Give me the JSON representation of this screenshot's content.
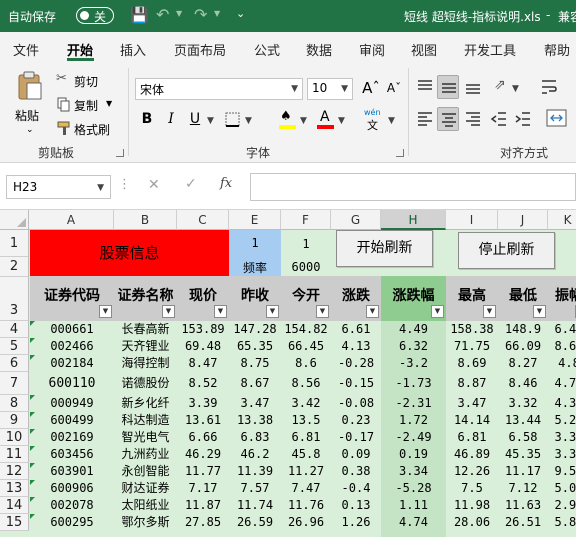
{
  "titlebar": {
    "autosave_label": "自动保存",
    "autosave_state": "关",
    "filename": "短线 超短线-指标说明.xls",
    "separator": "-",
    "user": "兼容"
  },
  "tabs": [
    "文件",
    "开始",
    "插入",
    "页面布局",
    "公式",
    "数据",
    "审阅",
    "视图",
    "开发工具",
    "帮助"
  ],
  "active_tab": "开始",
  "clipboard": {
    "paste": "粘贴",
    "cut": "剪切",
    "copy": "复制",
    "format_painter": "格式刷",
    "group": "剪贴板"
  },
  "font": {
    "name": "宋体",
    "size": "10",
    "bold": "B",
    "italic": "I",
    "underline": "U",
    "phonetic": "wén",
    "group": "字体"
  },
  "alignment": {
    "group": "对齐方式"
  },
  "formula_bar": {
    "name_box": "H23",
    "fx": "fx",
    "formula": ""
  },
  "columns": [
    "A",
    "B",
    "C",
    "E",
    "F",
    "G",
    "H",
    "I",
    "J",
    "K"
  ],
  "rows": [
    "1",
    "2",
    "3",
    "4",
    "5",
    "6",
    "7",
    "8",
    "9",
    "10",
    "11",
    "12",
    "13",
    "14",
    "15"
  ],
  "sheet": {
    "stock_info": "股票信息",
    "e1": "1",
    "e2": "频率",
    "f1": "1",
    "f2": "6000",
    "start_button": "开始刷新",
    "stop_button": "停止刷新",
    "headers": [
      "证券代码",
      "证券名称",
      "现价",
      "昨收",
      "今开",
      "涨跌",
      "涨跌幅",
      "最高",
      "最低",
      "振幅"
    ],
    "data": [
      [
        "000661",
        "长春高新",
        "153.89",
        "147.28",
        "154.82",
        "6.61",
        "4.49",
        "158.38",
        "148.9",
        "6.44"
      ],
      [
        "002466",
        "天齐锂业",
        "69.48",
        "65.35",
        "66.45",
        "4.13",
        "6.32",
        "71.75",
        "66.09",
        "8.66"
      ],
      [
        "002184",
        "海得控制",
        "8.47",
        "8.75",
        "8.6",
        "-0.28",
        "-3.2",
        "8.69",
        "8.27",
        "4.8"
      ],
      [
        "600110",
        "诺德股份",
        "8.52",
        "8.67",
        "8.56",
        "-0.15",
        "-1.73",
        "8.87",
        "8.46",
        "4.73"
      ],
      [
        "000949",
        "新乡化纤",
        "3.39",
        "3.47",
        "3.42",
        "-0.08",
        "-2.31",
        "3.47",
        "3.32",
        "4.32"
      ],
      [
        "600499",
        "科达制造",
        "13.61",
        "13.38",
        "13.5",
        "0.23",
        "1.72",
        "14.14",
        "13.44",
        "5.23"
      ],
      [
        "002169",
        "智光电气",
        "6.66",
        "6.83",
        "6.81",
        "-0.17",
        "-2.49",
        "6.81",
        "6.58",
        "3.37"
      ],
      [
        "603456",
        "九洲药业",
        "46.29",
        "46.2",
        "45.8",
        "0.09",
        "0.19",
        "46.89",
        "45.35",
        "3.33"
      ],
      [
        "603901",
        "永创智能",
        "11.77",
        "11.39",
        "11.27",
        "0.38",
        "3.34",
        "12.26",
        "11.17",
        "9.57"
      ],
      [
        "600906",
        "财达证券",
        "7.17",
        "7.57",
        "7.47",
        "-0.4",
        "-5.28",
        "7.5",
        "7.12",
        "5.02"
      ],
      [
        "002078",
        "太阳纸业",
        "11.87",
        "11.74",
        "11.76",
        "0.13",
        "1.11",
        "11.98",
        "11.63",
        "2.98"
      ],
      [
        "600295",
        "鄂尔多斯",
        "27.85",
        "26.59",
        "26.96",
        "1.26",
        "4.74",
        "28.06",
        "26.51",
        "5.83"
      ]
    ]
  },
  "colors": {
    "accent": "#217346",
    "cell_bg": "#d9efd9",
    "header_bg": "#cccccc",
    "red_block": "#ff0000",
    "blue_cell": "#a6ccf2",
    "selected_col": "#8fcc8f"
  }
}
